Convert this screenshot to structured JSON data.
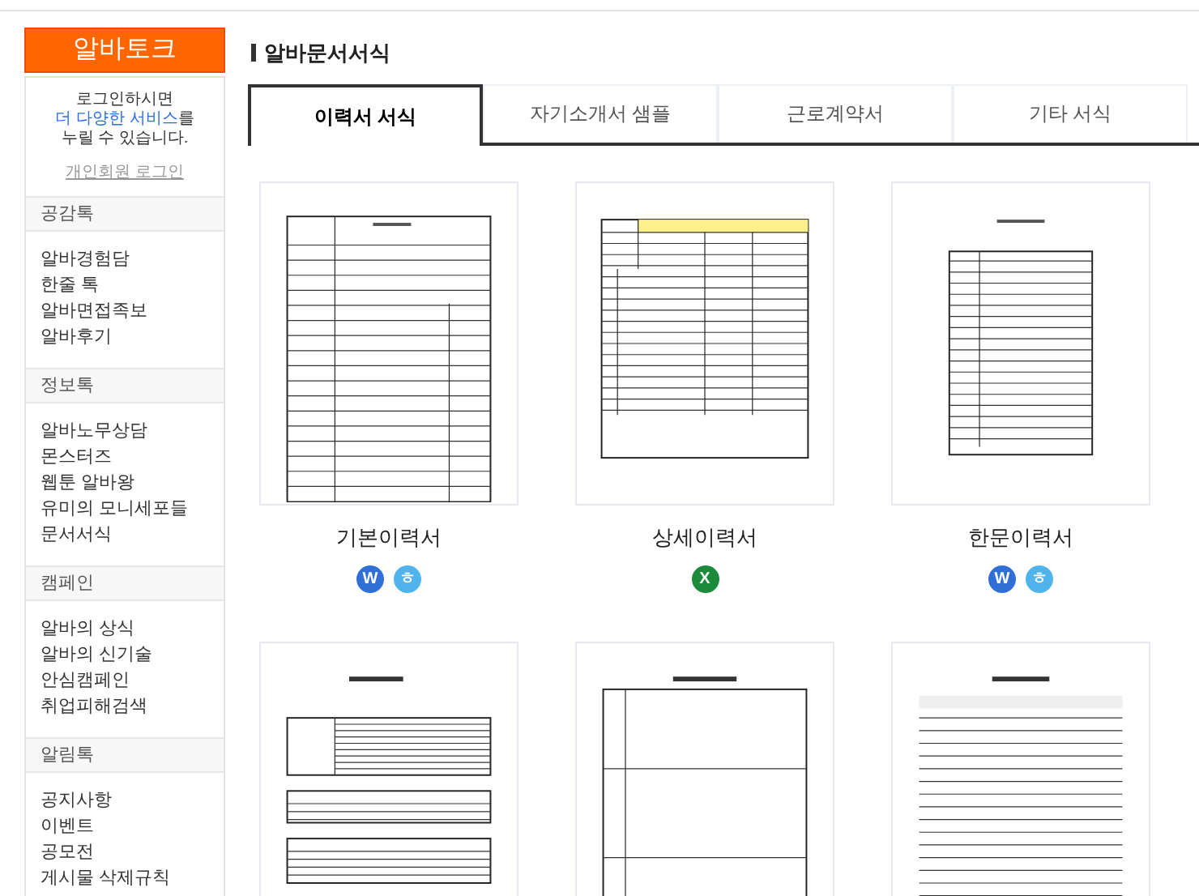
{
  "sidebar": {
    "logo": "알바토크",
    "login": {
      "lines": [
        "로그인하시면",
        "**더 다양한 서비스**를",
        "누릴 수 있습니다."
      ],
      "link": "개인회원 로그인"
    },
    "sections": [
      {
        "title": "공감톡",
        "items": [
          "알바경험담",
          "한줄 톡",
          "알바면접족보",
          "알바후기"
        ]
      },
      {
        "title": "정보톡",
        "items": [
          "알바노무상담",
          "몬스터즈",
          "웹툰 알바왕",
          "유미의 모니세포들",
          "문서서식"
        ]
      },
      {
        "title": "캠페인",
        "items": [
          "알바의 상식",
          "알바의 신기술",
          "안심캠페인",
          "취업피해검색"
        ]
      },
      {
        "title": "알림톡",
        "items": [
          "공지사항",
          "이벤트",
          "공모전",
          "게시물 삭제규칙"
        ]
      }
    ]
  },
  "main": {
    "title": "알바문서서식",
    "tabs": [
      {
        "label": "이력서 서식",
        "selected": true
      },
      {
        "label": "자기소개서 샘플",
        "selected": false
      },
      {
        "label": "근로계약서",
        "selected": false
      },
      {
        "label": "기타 서식",
        "selected": false
      }
    ],
    "cards": [
      {
        "kind": "basic",
        "name": "기본이력서",
        "files": [
          {
            "kind": "word",
            "label": "W"
          },
          {
            "kind": "hwp",
            "label": "ㅎ"
          }
        ]
      },
      {
        "kind": "detail",
        "name": "상세이력서",
        "files": [
          {
            "kind": "excel",
            "label": "X"
          }
        ]
      },
      {
        "kind": "hanmun",
        "name": "한문이력서",
        "files": [
          {
            "kind": "word",
            "label": "W"
          },
          {
            "kind": "hwp",
            "label": "ㅎ"
          }
        ]
      },
      {
        "kind": "english"
      },
      {
        "kind": "intro"
      },
      {
        "kind": "career"
      }
    ]
  }
}
